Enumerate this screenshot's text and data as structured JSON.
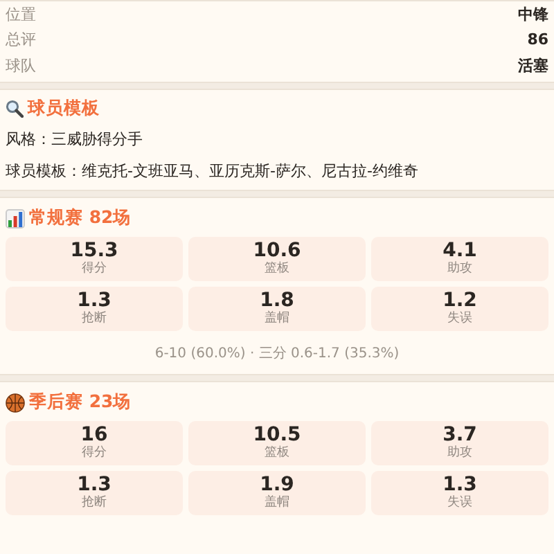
{
  "info": [
    {
      "label": "位置",
      "value": "中锋"
    },
    {
      "label": "总评",
      "value": "86"
    },
    {
      "label": "球队",
      "value": "活塞"
    }
  ],
  "template": {
    "title": "球员模板",
    "lines": [
      "风格：三威胁得分手",
      "球员模板：维克托-文班亚马、亚历克斯-萨尔、尼古拉-约维奇"
    ]
  },
  "seasons": [
    {
      "kind": "chart",
      "title": "常规赛 82场",
      "stats": [
        {
          "value": "15.3",
          "label": "得分"
        },
        {
          "value": "10.6",
          "label": "篮板"
        },
        {
          "value": "4.1",
          "label": "助攻"
        },
        {
          "value": "1.3",
          "label": "抢断"
        },
        {
          "value": "1.8",
          "label": "盖帽"
        },
        {
          "value": "1.2",
          "label": "失误"
        }
      ],
      "note": "6-10 (60.0%) · 三分 0.6-1.7 (35.3%)"
    },
    {
      "kind": "ball",
      "title": "季后赛 23场",
      "stats": [
        {
          "value": "16",
          "label": "得分"
        },
        {
          "value": "10.5",
          "label": "篮板"
        },
        {
          "value": "3.7",
          "label": "助攻"
        },
        {
          "value": "1.3",
          "label": "抢断"
        },
        {
          "value": "1.9",
          "label": "盖帽"
        },
        {
          "value": "1.3",
          "label": "失误"
        }
      ]
    }
  ]
}
